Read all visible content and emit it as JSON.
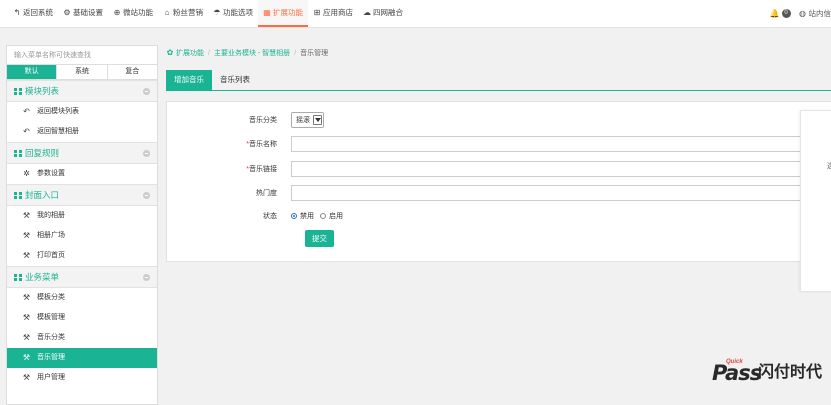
{
  "topnav": [
    {
      "icon": "back-arrow-icon",
      "glyph": "↰",
      "label": "返回系统"
    },
    {
      "icon": "gear-icon",
      "glyph": "⚙",
      "label": "基础设置"
    },
    {
      "icon": "globe-icon",
      "glyph": "⊕",
      "label": "微站功能"
    },
    {
      "icon": "gift-icon",
      "glyph": "⌂",
      "label": "粉丝营销"
    },
    {
      "icon": "umbrella-icon",
      "glyph": "☂",
      "label": "功能选项"
    },
    {
      "icon": "cubes-icon",
      "glyph": "▦",
      "label": "扩展功能",
      "active": true
    },
    {
      "icon": "cart-icon",
      "glyph": "⊞",
      "label": "应用商店"
    },
    {
      "icon": "cloud-icon",
      "glyph": "☁",
      "label": "四网融合"
    }
  ],
  "notifications": {
    "count": "0"
  },
  "message_label": "站内信",
  "sidebar": {
    "search_placeholder": "输入菜单名称可快速查找",
    "tabs": [
      "默认",
      "系统",
      "复合"
    ],
    "groups": [
      {
        "title": "模块列表",
        "items": [
          {
            "icon": "reply-icon",
            "glyph": "↶",
            "label": "返回模块列表"
          },
          {
            "icon": "reply-icon",
            "glyph": "↶",
            "label": "返回智慧相册"
          }
        ]
      },
      {
        "title": "回复规则",
        "items": [
          {
            "icon": "gear-icon",
            "glyph": "✲",
            "label": "参数设置"
          }
        ]
      },
      {
        "title": "封面入口",
        "items": [
          {
            "icon": "tool-icon",
            "glyph": "⚒",
            "label": "我的相册"
          },
          {
            "icon": "tool-icon",
            "glyph": "⚒",
            "label": "相册广场"
          },
          {
            "icon": "tool-icon",
            "glyph": "⚒",
            "label": "打印首页"
          }
        ]
      },
      {
        "title": "业务菜单",
        "items": [
          {
            "icon": "tool-icon",
            "glyph": "⚒",
            "label": "模板分类"
          },
          {
            "icon": "tool-icon",
            "glyph": "⚒",
            "label": "模板管理"
          },
          {
            "icon": "tool-icon",
            "glyph": "⚒",
            "label": "音乐分类"
          },
          {
            "icon": "tool-icon",
            "glyph": "⚒",
            "label": "音乐管理",
            "active": true
          },
          {
            "icon": "tool-icon",
            "glyph": "⚒",
            "label": "用户管理"
          }
        ]
      }
    ]
  },
  "breadcrumb": {
    "root": "扩展功能",
    "module": "主要业务模块 - 智慧相册",
    "current": "音乐管理"
  },
  "content_tabs": [
    "增加音乐",
    "音乐列表"
  ],
  "form": {
    "category": {
      "label": "音乐分类",
      "value": "摇滚"
    },
    "name": {
      "label": "音乐名称",
      "required_mark": "*",
      "value": ""
    },
    "link": {
      "label": "音乐链接",
      "required_mark": "*",
      "value": "",
      "trailing_text": "选"
    },
    "popularity": {
      "label": "热门度",
      "value": ""
    },
    "status": {
      "label": "状态",
      "options": [
        "禁用",
        "启用"
      ],
      "selected": "禁用"
    },
    "submit_label": "提交"
  },
  "watermark": {
    "brand_latin": "Pass",
    "quick": "Quick",
    "brand_cn": "闪付时代"
  }
}
